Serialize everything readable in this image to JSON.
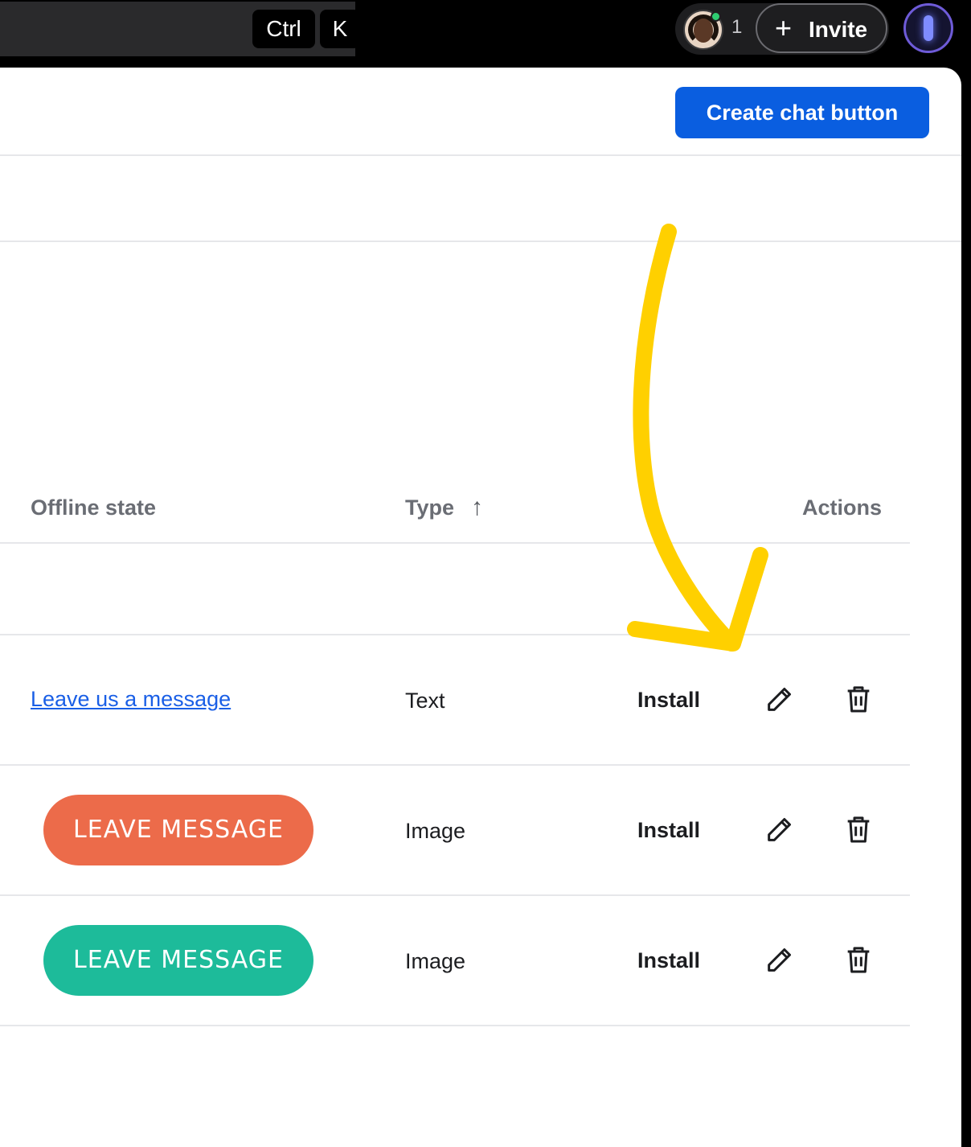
{
  "topbar": {
    "kbd_ctrl": "Ctrl",
    "kbd_k": "K",
    "presence_count": "1",
    "invite_label": "Invite",
    "online_color": "#2ecc71"
  },
  "toolbar": {
    "create_label": "Create chat button",
    "accent": "#0a5ee0"
  },
  "table": {
    "headers": {
      "offline": "Offline state",
      "type": "Type",
      "actions": "Actions"
    },
    "sort": "ascending",
    "rows": [
      {
        "offline_text": "Leave us a message",
        "type": "Text",
        "install": "Install"
      },
      {
        "offline_button": "LEAVE MESSAGE",
        "button_color": "#ec6b4a",
        "type": "Image",
        "install": "Install"
      },
      {
        "offline_button": "LEAVE MESSAGE",
        "button_color": "#1dbb9a",
        "type": "Image",
        "install": "Install"
      }
    ]
  },
  "annotation": {
    "arrow_color": "#ffd000",
    "icon": "hand-drawn-arrow"
  }
}
